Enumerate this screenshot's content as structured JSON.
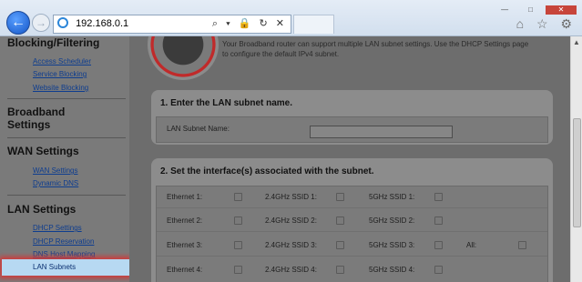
{
  "browser": {
    "address": "192.168.0.1",
    "address_tools": "⌕ ▾ 🔒 ↻ ✕",
    "window_controls": [
      "—",
      "□",
      "✕"
    ],
    "nav_icons": [
      "⌂",
      "☆",
      "⚙"
    ]
  },
  "sidebar": {
    "sections": [
      {
        "heading": "Blocking/Filtering",
        "links": [
          "Access Scheduler",
          "Service Blocking",
          "Website Blocking"
        ]
      },
      {
        "heading": "Broadband Settings",
        "links": []
      },
      {
        "heading": "WAN Settings",
        "links": [
          "WAN Settings",
          "Dynamic DNS"
        ]
      },
      {
        "heading": "LAN Settings",
        "links": [
          "DHCP Settings",
          "DHCP Reservation",
          "DNS Host Mapping"
        ]
      }
    ],
    "selected": "LAN Subnets"
  },
  "main": {
    "intro": "Your Broadband router can support multiple LAN subnet settings. Use the DHCP Settings page to configure the default IPv4 subnet.",
    "step1": {
      "title": "1. Enter the LAN subnet name.",
      "label": "LAN Subnet Name:",
      "value": ""
    },
    "step2": {
      "title": "2. Set the interface(s) associated with the subnet.",
      "rows": [
        {
          "eth": "Ethernet 1:",
          "ssid24": "2.4GHz SSID 1:",
          "ssid5": "5GHz SSID 1:"
        },
        {
          "eth": "Ethernet 2:",
          "ssid24": "2.4GHz SSID 2:",
          "ssid5": "5GHz SSID 2:"
        },
        {
          "eth": "Ethernet 3:",
          "ssid24": "2.4GHz SSID 3:",
          "ssid5": "5GHz SSID 3:",
          "all": "All:"
        },
        {
          "eth": "Ethernet 4:",
          "ssid24": "2.4GHz SSID 4:",
          "ssid5": "5GHz SSID 4:"
        }
      ]
    }
  }
}
